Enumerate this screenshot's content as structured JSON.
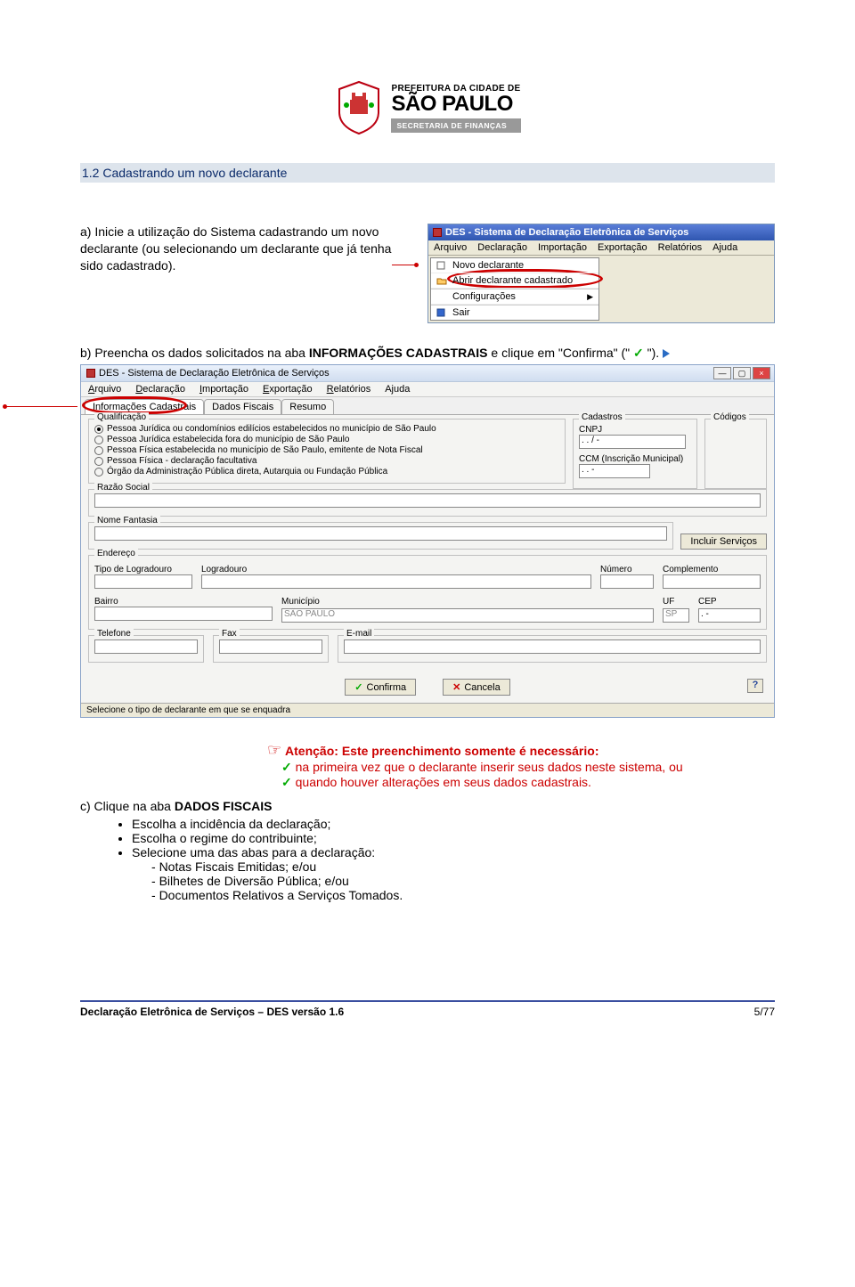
{
  "header": {
    "prefeitura_line": "PREFEITURA DA CIDADE DE",
    "sao_paulo": "SÃO PAULO",
    "secretaria": "SECRETARIA DE FINANÇAS"
  },
  "section": {
    "title": "1.2 Cadastrando um novo declarante"
  },
  "step_a": {
    "text": "a)  Inicie a utilização do Sistema cadastrando um novo declarante (ou selecionando um declarante que já tenha sido cadastrado)."
  },
  "mini_window": {
    "title": "DES - Sistema de Declaração Eletrônica de Serviços",
    "menu": [
      "Arquivo",
      "Declaração",
      "Importação",
      "Exportação",
      "Relatórios",
      "Ajuda"
    ],
    "items": {
      "novo": "Novo declarante",
      "abrir": "Abrir declarante cadastrado",
      "config": "Configurações",
      "sair": "Sair"
    }
  },
  "step_b": {
    "prefix": "b)  Preencha os dados solicitados na aba ",
    "bold": "INFORMAÇÕES CADASTRAIS",
    "suffix1": " e clique em \"Confirma\" (\" ",
    "suffix2": " \")."
  },
  "app": {
    "title": "DES - Sistema de Declaração Eletrônica de Serviços",
    "menu": [
      "Arquivo",
      "Declaração",
      "Importação",
      "Exportação",
      "Relatórios",
      "Ajuda"
    ],
    "tabs": {
      "info": "Informações Cadastrais",
      "dados": "Dados Fiscais",
      "resumo": "Resumo"
    },
    "qualificacao_label": "Qualificação",
    "radios": [
      "Pessoa Jurídica ou condomínios edilícios estabelecidos no município de São Paulo",
      "Pessoa Jurídica estabelecida fora do município de São Paulo",
      "Pessoa Física estabelecida no município de São Paulo, emitente de Nota Fiscal",
      "Pessoa Física - declaração facultativa",
      "Órgão da Administração Pública direta, Autarquia ou Fundação Pública"
    ],
    "cadastros_label": "Cadastros",
    "cnpj_label": "CNPJ",
    "cnpj_value": ". . / -",
    "ccm_label": "CCM (Inscrição Municipal)",
    "ccm_value": ". . -",
    "codigos_label": "Códigos",
    "razao_label": "Razão Social",
    "nome_label": "Nome Fantasia",
    "incluir_btn": "Incluir Serviços",
    "endereco_label": "Endereço",
    "tipo_log_label": "Tipo de Logradouro",
    "log_label": "Logradouro",
    "num_label": "Número",
    "comp_label": "Complemento",
    "bairro_label": "Bairro",
    "mun_label": "Município",
    "mun_value": "SÃO PAULO",
    "uf_label": "UF",
    "uf_value": "SP",
    "cep_label": "CEP",
    "cep_value": ". -",
    "tel_label": "Telefone",
    "fax_label": "Fax",
    "email_label": "E-mail",
    "confirma_btn": "Confirma",
    "cancela_btn": "Cancela",
    "status": "Selecione o tipo de declarante em que se enquadra",
    "help": "?"
  },
  "attention": {
    "title": "Atenção: Este preenchimento somente é necessário:",
    "li1": "na primeira vez que o declarante inserir seus dados neste sistema, ou",
    "li2": "quando houver alterações em seus dados cadastrais."
  },
  "step_c": {
    "prefix": "c)  Clique na aba ",
    "bold": "DADOS FISCAIS",
    "bullets": [
      "Escolha a incidência da declaração;",
      "Escolha o regime do contribuinte;",
      "Selecione uma das abas para a declaração:"
    ],
    "subs": [
      "Notas Fiscais Emitidas; e/ou",
      "Bilhetes de Diversão Pública; e/ou",
      "Documentos Relativos a Serviços Tomados."
    ]
  },
  "footer": {
    "left": "Declaração Eletrônica de Serviços – DES versão 1.6",
    "right": "5/77"
  }
}
